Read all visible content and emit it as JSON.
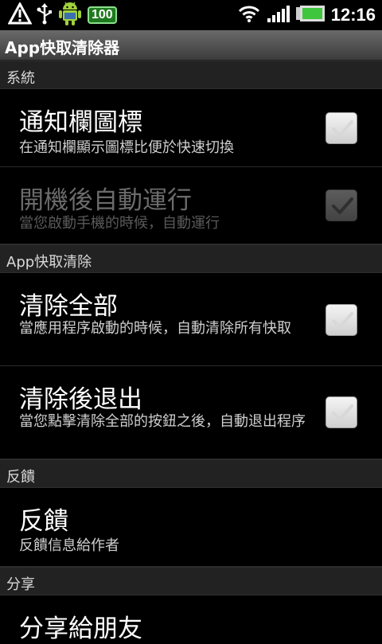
{
  "status_bar": {
    "time": "12:16",
    "battery_badge": "100"
  },
  "app_title": "App快取清除器",
  "sections": {
    "system": "系統",
    "cache": "App快取清除",
    "feedback": "反饋",
    "share": "分享"
  },
  "prefs": {
    "notification_icon": {
      "title": "通知欄圖標",
      "summary": "在通知欄顯示圖標比便於快速切換",
      "checked": true,
      "enabled": true
    },
    "autostart": {
      "title": "開機後自動運行",
      "summary": "當您啟動手機的時候，自動運行",
      "checked": true,
      "enabled": false
    },
    "clear_all": {
      "title": "清除全部",
      "summary": "當應用程序啟動的時候，自動清除所有快取",
      "checked": true,
      "enabled": true
    },
    "exit_after_clear": {
      "title": "清除後退出",
      "summary": "當您點擊清除全部的按鈕之後，自動退出程序",
      "checked": true,
      "enabled": true
    },
    "feedback": {
      "title": "反饋",
      "summary": "反饋信息給作者"
    },
    "share": {
      "title": "分享給朋友"
    }
  },
  "icons": {
    "warning": "warning-icon",
    "usb": "usb-icon",
    "android": "android-icon",
    "wifi": "wifi-icon",
    "signal": "signal-icon",
    "battery": "battery-icon",
    "check": "check-icon"
  },
  "colors": {
    "background": "#000000",
    "section_header": "#222222",
    "title_bar_top": "#6a6a6a",
    "title_bar_bottom": "#3c3c3c",
    "battery_green": "#3ec63e"
  }
}
